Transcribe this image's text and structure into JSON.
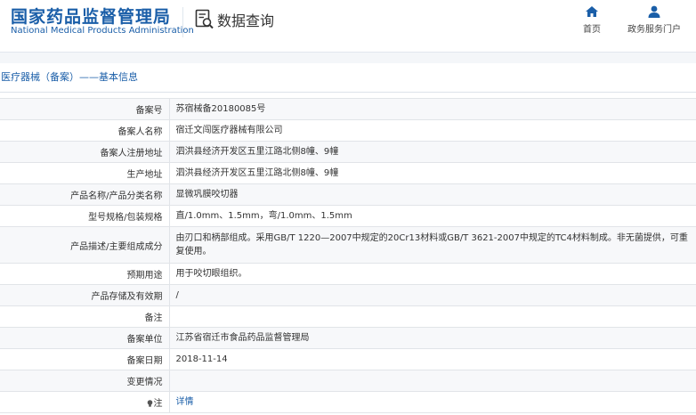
{
  "header": {
    "logo_cn": "国家药品监督管理局",
    "logo_en": "National Medical Products Administration",
    "query_label": "数据查询",
    "nav": [
      {
        "label": "首页",
        "icon": "home-icon"
      },
      {
        "label": "政务服务门户",
        "icon": "user-icon"
      }
    ]
  },
  "breadcrumb": "医疗器械（备案）——基本信息",
  "rows": [
    {
      "label": "备案号",
      "value": "苏宿械备20180085号"
    },
    {
      "label": "备案人名称",
      "value": "宿迁文闯医疗器械有限公司"
    },
    {
      "label": "备案人注册地址",
      "value": "泗洪县经济开发区五里江路北侧8幢、9幢"
    },
    {
      "label": "生产地址",
      "value": "泗洪县经济开发区五里江路北侧8幢、9幢"
    },
    {
      "label": "产品名称/产品分类名称",
      "value": "显微巩膜咬切器"
    },
    {
      "label": "型号规格/包装规格",
      "value": "直/1.0mm、1.5mm，弯/1.0mm、1.5mm"
    },
    {
      "label": "产品描述/主要组成成分",
      "value": "由刃口和柄部组成。采用GB/T 1220—2007中规定的20Cr13材料或GB/T 3621-2007中规定的TC4材料制成。非无菌提供，可重复使用。"
    },
    {
      "label": "预期用途",
      "value": "用于咬切眼组织。"
    },
    {
      "label": "产品存储及有效期",
      "value": "/"
    },
    {
      "label": "备注",
      "value": ""
    },
    {
      "label": "备案单位",
      "value": "江苏省宿迁市食品药品监督管理局"
    },
    {
      "label": "备案日期",
      "value": "2018-11-14"
    },
    {
      "label": "变更情况",
      "value": ""
    },
    {
      "label": "注",
      "value": "详情"
    }
  ]
}
